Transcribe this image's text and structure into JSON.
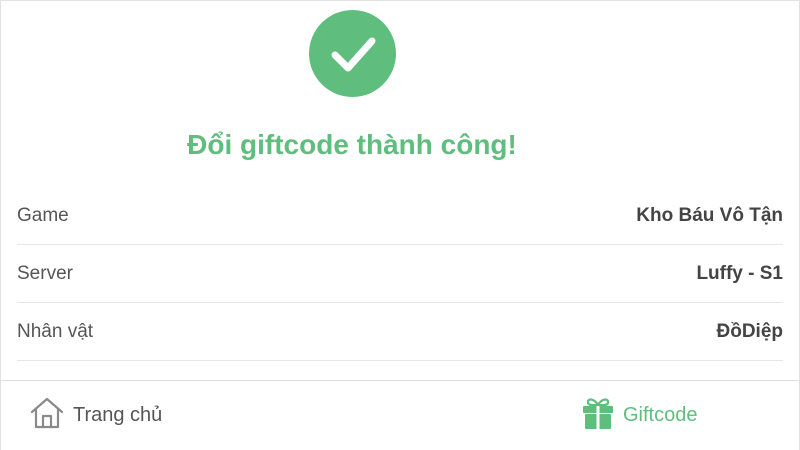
{
  "result": {
    "title": "Đổi giftcode thành công!"
  },
  "details": [
    {
      "label": "Game",
      "value": "Kho Báu Vô Tận"
    },
    {
      "label": "Server",
      "value": "Luffy - S1"
    },
    {
      "label": "Nhân vật",
      "value": "ĐồDiệp"
    }
  ],
  "nav": {
    "home_label": "Trang chủ",
    "giftcode_label": "Giftcode"
  },
  "icons": {
    "success": "check-circle-icon",
    "home": "home-icon",
    "gift": "gift-icon"
  },
  "colors": {
    "accent": "#5fbe7d",
    "text": "#555555"
  }
}
